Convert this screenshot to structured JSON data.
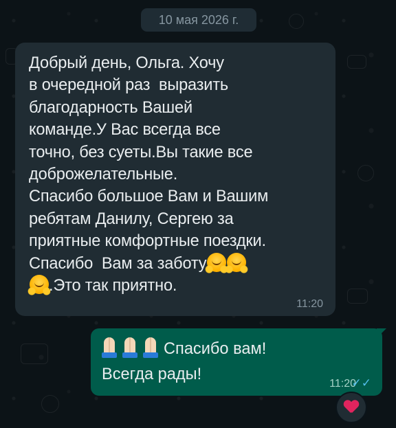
{
  "chat": {
    "date_chip": "10 мая 2026 г.",
    "incoming_message": {
      "lines": [
        "Добрый день, Ольга. Хочу",
        "в очередной раз  выразить",
        "благодарность Вашей",
        "команде.У Вас всегда все",
        "точно, без суеты.Вы такие все",
        "доброжелательные.",
        "Спасибо большое Вам и Вашим",
        "ребятам Данилу, Сергею за",
        "приятные комфортные поездки.",
        "Спасибо  Вам за заботу",
        ".Это так приятно."
      ],
      "emoji": "hugging-face",
      "time": "11:20"
    },
    "outgoing_message": {
      "line1": "Спасибо вам!",
      "line2": "Всегда рады!",
      "emoji": "folded-hands",
      "time": "11:20",
      "status": "✓✓"
    },
    "reaction": "red-heart"
  }
}
